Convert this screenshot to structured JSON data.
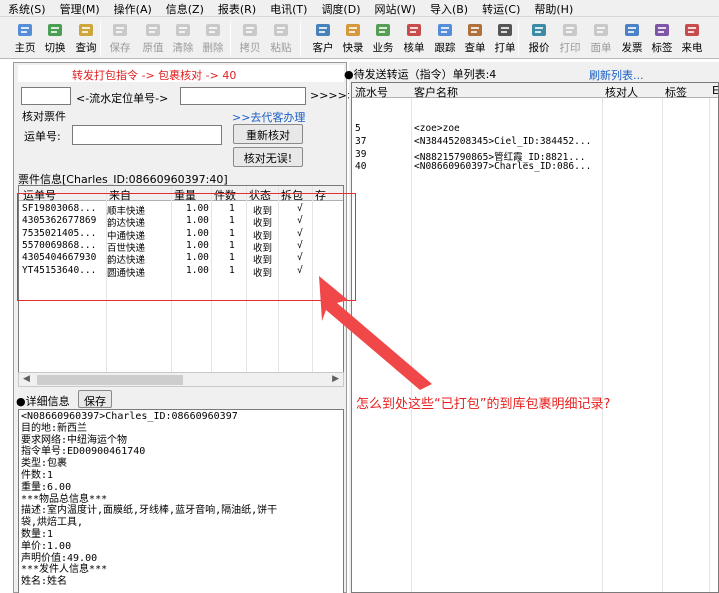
{
  "menu": [
    "系统(S)",
    "管理(M)",
    "操作(A)",
    "信息(Z)",
    "报表(R)",
    "电讯(T)",
    "调度(D)",
    "网站(W)",
    "导入(B)",
    "转运(C)",
    "帮助(H)"
  ],
  "toolbar": [
    {
      "label": "主页",
      "icon": "home-icon",
      "enabled": true
    },
    {
      "label": "切换",
      "icon": "switch-icon",
      "enabled": true
    },
    {
      "label": "查询",
      "icon": "query-icon",
      "enabled": true
    },
    {
      "label": "保存",
      "icon": "save-icon",
      "enabled": false
    },
    {
      "label": "原值",
      "icon": "restore-icon",
      "enabled": false
    },
    {
      "label": "清除",
      "icon": "clear-icon",
      "enabled": false
    },
    {
      "label": "删除",
      "icon": "delete-icon",
      "enabled": false
    },
    {
      "label": "拷贝",
      "icon": "copy-icon",
      "enabled": false
    },
    {
      "label": "粘贴",
      "icon": "paste-icon",
      "enabled": false
    },
    {
      "label": "客户",
      "icon": "customer-icon",
      "enabled": true
    },
    {
      "label": "快录",
      "icon": "quick-entry-icon",
      "enabled": true
    },
    {
      "label": "业务",
      "icon": "business-icon",
      "enabled": true
    },
    {
      "label": "核单",
      "icon": "verify-icon",
      "enabled": true
    },
    {
      "label": "跟踪",
      "icon": "track-icon",
      "enabled": true
    },
    {
      "label": "查单",
      "icon": "check-order-icon",
      "enabled": true
    },
    {
      "label": "打单",
      "icon": "print-order-icon",
      "enabled": true
    },
    {
      "label": "报价",
      "icon": "quote-icon",
      "enabled": true
    },
    {
      "label": "打印",
      "icon": "print-icon",
      "enabled": false
    },
    {
      "label": "面单",
      "icon": "waybill-icon",
      "enabled": false
    },
    {
      "label": "发票",
      "icon": "invoice-icon",
      "enabled": true
    },
    {
      "label": "标签",
      "icon": "label-icon",
      "enabled": true
    },
    {
      "label": "来电",
      "icon": "phone-icon",
      "enabled": true
    }
  ],
  "left": {
    "banner": "转发打包指令 -> 包裹核对 -> 40",
    "locate_placeholder": "<-流水定位单号->",
    "forward_arrows": ">>>>>",
    "verify_section_label": "核对票件",
    "goto_customer_link": ">>去代客办理",
    "waybill_label": "运单号:",
    "reverify_button": "重新核对",
    "verify_ok_button": "核对无误!",
    "grid_title": "票件信息[Charles_ID:08660960397:40]",
    "grid_headers": [
      "运单号",
      "来自",
      "重量",
      "件数",
      "状态",
      "拆包",
      "存"
    ],
    "grid_rows": [
      [
        "SF19803068...",
        "顺丰快递",
        "1.00",
        "1",
        "收到",
        "√"
      ],
      [
        "4305362677869",
        "韵达快递",
        "1.00",
        "1",
        "收到",
        "√"
      ],
      [
        "7535021405...",
        "中通快递",
        "1.00",
        "1",
        "收到",
        "√"
      ],
      [
        "5570069868...",
        "百世快递",
        "1.00",
        "1",
        "收到",
        "√"
      ],
      [
        "4305404667930",
        "韵达快递",
        "1.00",
        "1",
        "收到",
        "√"
      ],
      [
        "YT45153640...",
        "圆通快递",
        "1.00",
        "1",
        "收到",
        "√"
      ]
    ],
    "detail_label": "●详细信息",
    "save_button": "保存",
    "detail_lines": [
      "<N08660960397>Charles_ID:08660960397",
      "目的地:新西兰",
      "要求网络:中纽海运个物",
      "指令单号:ED00900461740",
      "类型:包裹",
      "件数:1",
      "重量:6.00",
      "***物品总信息***",
      " 描述:室内温度计,面膜纸,牙线棒,蓝牙音响,隔油纸,饼干",
      "袋,烘焙工具,",
      " 数量:1",
      " 单价:1.00",
      " 声明价值:49.00",
      "***发件人信息***",
      " 姓名:姓名"
    ]
  },
  "right": {
    "title": "●待发送转运（指令）单列表:4",
    "refresh_link": "刷新列表...",
    "headers": [
      "流水号",
      "客户名称",
      "核对人",
      "标签",
      "E"
    ],
    "rows": [
      [
        "5",
        "<zoe>zoe"
      ],
      [
        "37",
        "<N38445208345>Ciel_ID:384452..."
      ],
      [
        "39",
        "<N88215790865>管红霞_ID:8821..."
      ],
      [
        "40",
        "<N08660960397>Charles_ID:086..."
      ]
    ]
  },
  "annotation": "怎么到处这些“已打包”的到库包裹明细记录?",
  "colors": {
    "annotation": "#e82020",
    "banner_text": "#e02020",
    "link": "#1a5fc6"
  }
}
